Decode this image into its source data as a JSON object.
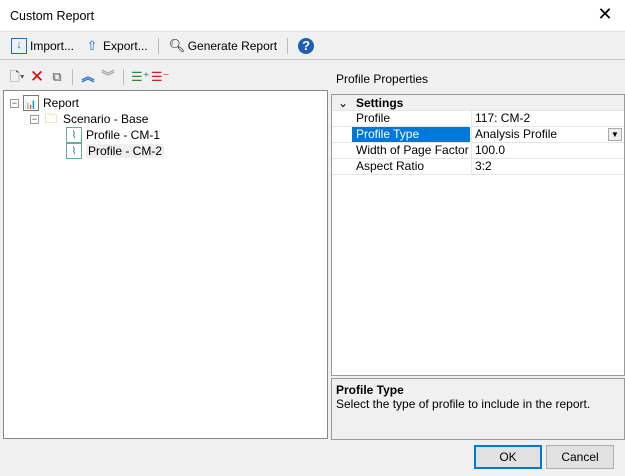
{
  "window": {
    "title": "Custom Report"
  },
  "toolbar": {
    "import": "Import...",
    "export": "Export...",
    "generate": "Generate Report"
  },
  "tree": {
    "root": "Report",
    "scenario": "Scenario - Base",
    "profiles": [
      "Profile - CM-1",
      "Profile - CM-2"
    ]
  },
  "properties": {
    "header": "Profile Properties",
    "category": "Settings",
    "rows": [
      {
        "key": "Profile",
        "value": "117: CM-2"
      },
      {
        "key": "Profile Type",
        "value": "Analysis Profile"
      },
      {
        "key": "Width of Page Factor (%)",
        "value": "100.0"
      },
      {
        "key": "Aspect Ratio",
        "value": "3:2"
      }
    ],
    "description_title": "Profile Type",
    "description": "Select the type of profile to include in the report."
  },
  "buttons": {
    "ok": "OK",
    "cancel": "Cancel"
  },
  "colors": {
    "selection": "#0078d7",
    "accent": "#1e6fc4"
  }
}
